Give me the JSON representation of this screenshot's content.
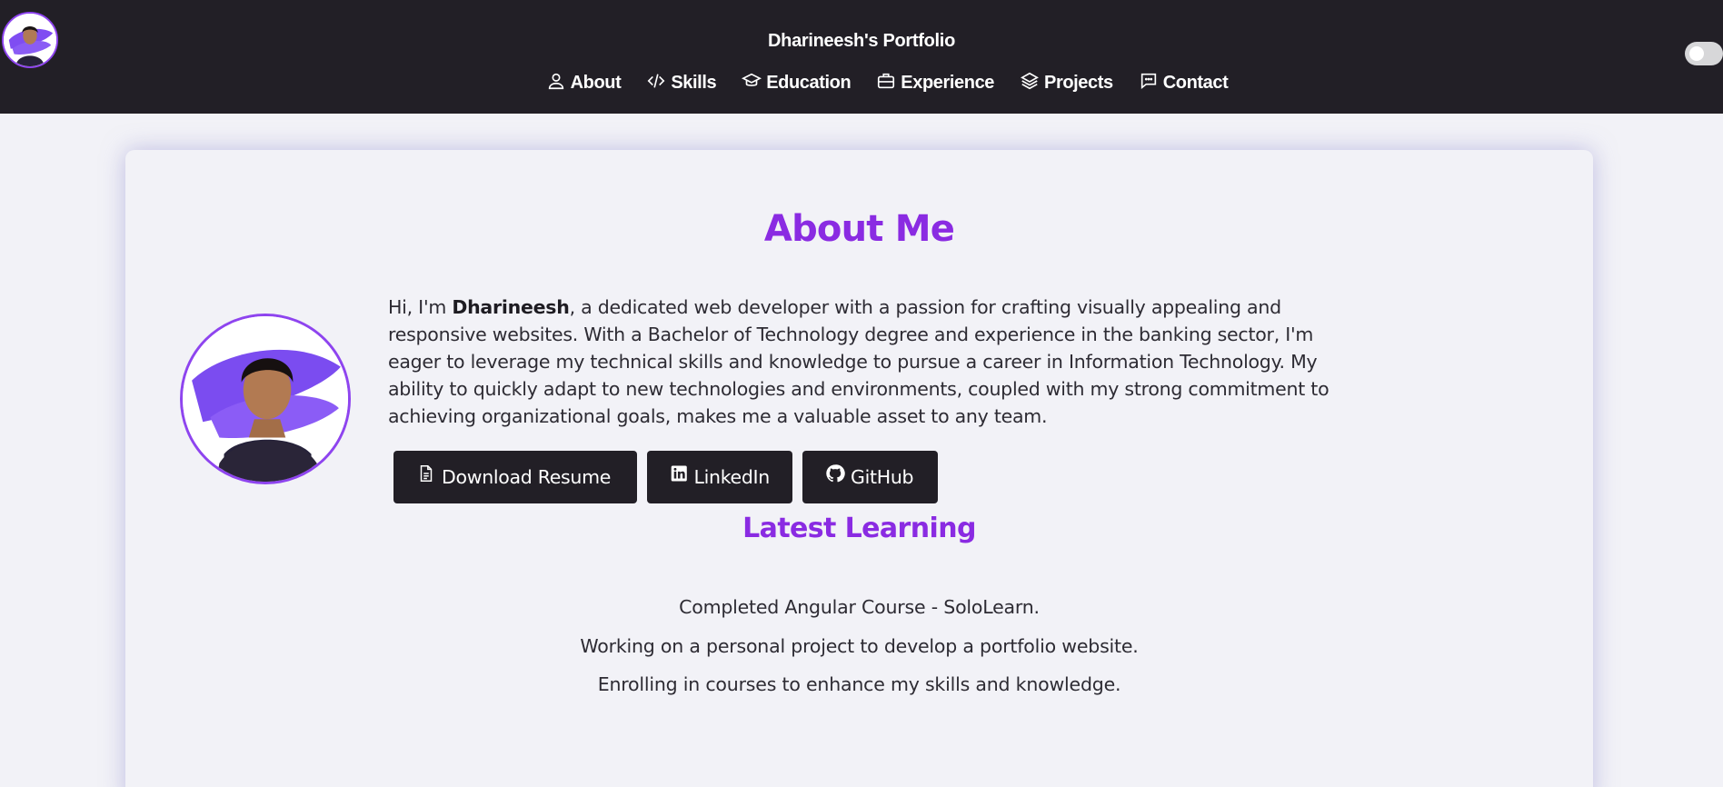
{
  "header": {
    "site_title": "Dharineesh's Portfolio",
    "nav": [
      {
        "label": "About",
        "icon": "user-icon"
      },
      {
        "label": "Skills",
        "icon": "code-icon"
      },
      {
        "label": "Education",
        "icon": "graduation-cap-icon"
      },
      {
        "label": "Experience",
        "icon": "briefcase-icon"
      },
      {
        "label": "Projects",
        "icon": "layers-icon"
      },
      {
        "label": "Contact",
        "icon": "chat-bubble-icon"
      }
    ],
    "theme_toggle": {
      "state": "off"
    }
  },
  "about": {
    "title": "About Me",
    "bio_intro": "Hi, I'm ",
    "bio_name": "Dharineesh",
    "bio_rest": ", a dedicated web developer with a passion for crafting visually appealing and responsive websites. With a Bachelor of Technology degree and experience in the banking sector, I'm eager to leverage my technical skills and knowledge to pursue a career in Information Technology. My ability to quickly adapt to new technologies and environments, coupled with my strong commitment to achieving organizational goals, makes me a valuable asset to any team.",
    "buttons": {
      "resume": "Download Resume",
      "linkedin": "LinkedIn",
      "github": "GitHub"
    }
  },
  "learning": {
    "title": "Latest Learning",
    "items": [
      "Completed Angular Course - SoloLearn.",
      "Working on a personal project to develop a portfolio website.",
      "Enrolling in courses to enhance my skills and knowledge."
    ]
  },
  "colors": {
    "accent": "#8a2be2",
    "header_bg": "#221f26",
    "page_bg": "#f2f2f7",
    "button_bg": "#221f26"
  }
}
